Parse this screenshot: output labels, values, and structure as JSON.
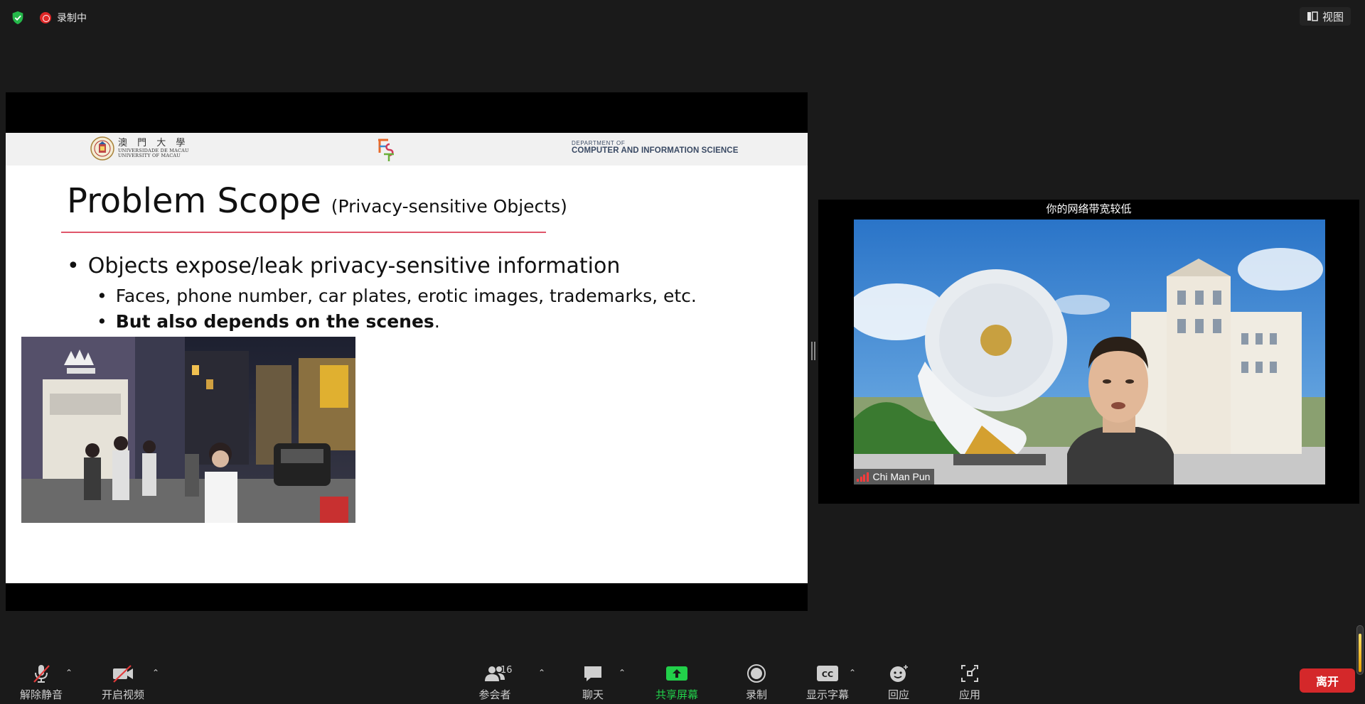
{
  "topbar": {
    "recording_label": "录制中",
    "view_label": "视图"
  },
  "slide": {
    "university_cn": "澳 門 大 學",
    "university_pt": "UNIVERSIDADE DE MACAU",
    "university_en": "UNIVERSITY OF MACAU",
    "department_small": "DEPARTMENT OF",
    "department_name": "COMPUTER AND INFORMATION SCIENCE",
    "title": "Problem Scope",
    "subtitle": "(Privacy-sensitive Objects)",
    "bullet_marker": "•",
    "bullet_1": "Objects expose/leak privacy-sensitive information",
    "bullet_1_1": "Faces, phone number, car plates, erotic images, trademarks, etc.",
    "bullet_1_2_bold": "But also depends on the scenes",
    "bullet_1_2_tail": "."
  },
  "video": {
    "network_warning": "你的网络带宽较低",
    "participant_name": "Chi Man Pun"
  },
  "toolbar": {
    "unmute_label": "解除静音",
    "start_video_label": "开启视频",
    "participants_label": "参会者",
    "participants_count": "16",
    "chat_label": "聊天",
    "share_label": "共享屏幕",
    "record_label": "录制",
    "captions_label": "显示字幕",
    "captions_icon_text": "CC",
    "reactions_label": "回应",
    "apps_label": "应用",
    "leave_label": "离开"
  },
  "colors": {
    "background": "#1a1a1a",
    "share_green": "#22d04a",
    "leave_red": "#d4282a",
    "title_rule": "#e0566a"
  }
}
